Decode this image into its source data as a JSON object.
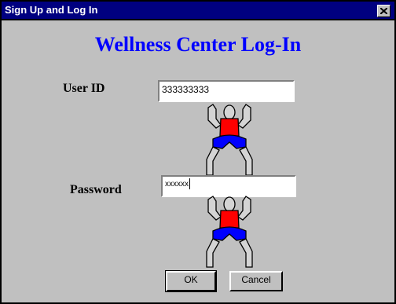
{
  "window": {
    "title": "Sign Up and Log In"
  },
  "heading": "Wellness Center Log-In",
  "form": {
    "user_id_label": "User ID",
    "user_id_value": "333333333",
    "password_label": "Password",
    "password_value": "xxxxxx"
  },
  "buttons": {
    "ok_label": "OK",
    "cancel_label": "Cancel"
  },
  "icons": {
    "close": "close-x-icon",
    "figure": "weightlifter-figure"
  },
  "colors": {
    "titlebar": "#000080",
    "heading": "#0000ff",
    "shirt": "#ff0000",
    "shorts": "#0000ff",
    "background": "#c0c0c0"
  }
}
